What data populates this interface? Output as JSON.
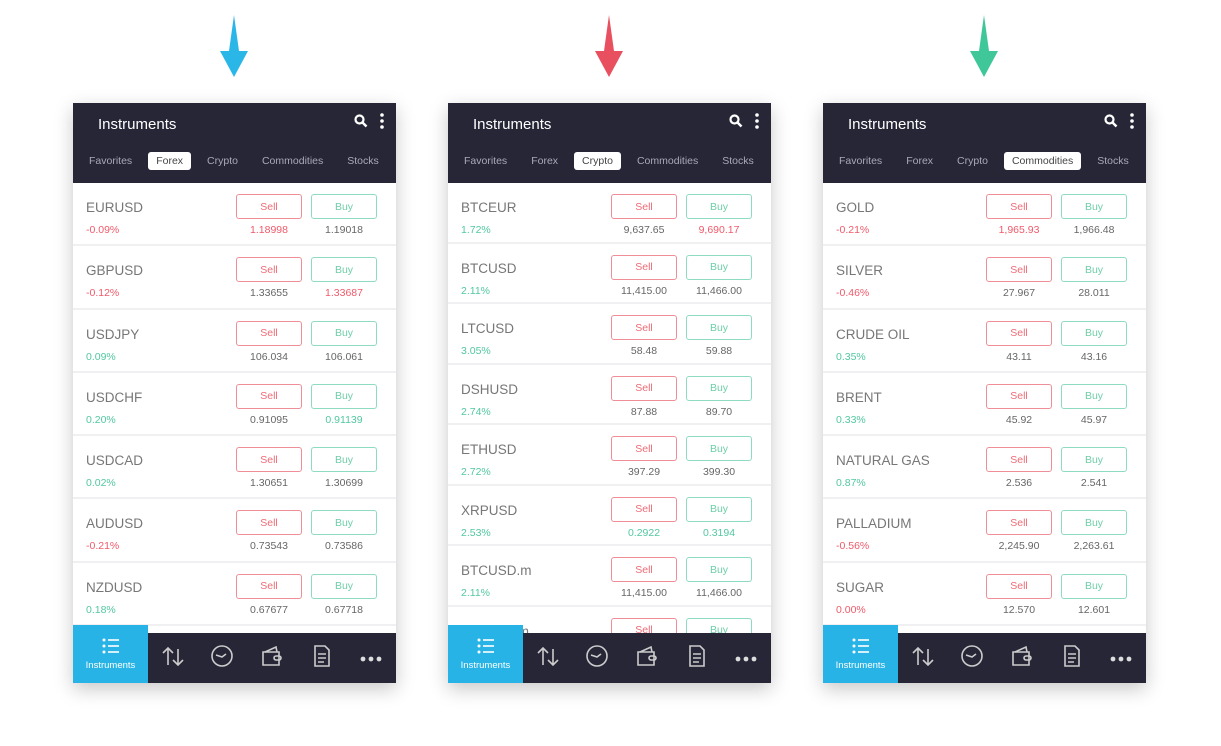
{
  "colors": {
    "arrows": [
      "#2ab7e8",
      "#e8505f",
      "#3fc79a"
    ],
    "accent": "#27b3e6",
    "header_bg": "#262637",
    "up": "#52c8a1",
    "down": "#ef5a6a"
  },
  "panels": [
    {
      "title": "Instruments",
      "tabs": [
        "Favorites",
        "Forex",
        "Crypto",
        "Commodities",
        "Stocks"
      ],
      "active_tab": 1,
      "rows": [
        {
          "name": "EURUSD",
          "change": "-0.09%",
          "change_dir": "down",
          "sell": "1.18998",
          "sell_dir": "down",
          "buy": "1.19018",
          "buy_dir": "neutral"
        },
        {
          "name": "GBPUSD",
          "change": "-0.12%",
          "change_dir": "down",
          "sell": "1.33655",
          "sell_dir": "neutral",
          "buy": "1.33687",
          "buy_dir": "down"
        },
        {
          "name": "USDJPY",
          "change": "0.09%",
          "change_dir": "up",
          "sell": "106.034",
          "sell_dir": "neutral",
          "buy": "106.061",
          "buy_dir": "neutral"
        },
        {
          "name": "USDCHF",
          "change": "0.20%",
          "change_dir": "up",
          "sell": "0.91095",
          "sell_dir": "neutral",
          "buy": "0.91139",
          "buy_dir": "up"
        },
        {
          "name": "USDCAD",
          "change": "0.02%",
          "change_dir": "up",
          "sell": "1.30651",
          "sell_dir": "neutral",
          "buy": "1.30699",
          "buy_dir": "neutral"
        },
        {
          "name": "AUDUSD",
          "change": "-0.21%",
          "change_dir": "down",
          "sell": "0.73543",
          "sell_dir": "neutral",
          "buy": "0.73586",
          "buy_dir": "neutral"
        },
        {
          "name": "NZDUSD",
          "change": "0.18%",
          "change_dir": "up",
          "sell": "0.67677",
          "sell_dir": "neutral",
          "buy": "0.67718",
          "buy_dir": "neutral"
        }
      ]
    },
    {
      "title": "Instruments",
      "tabs": [
        "Favorites",
        "Forex",
        "Crypto",
        "Commodities",
        "Stocks"
      ],
      "active_tab": 2,
      "rows": [
        {
          "name": "BTCEUR",
          "change": "1.72%",
          "change_dir": "up",
          "sell": "9,637.65",
          "sell_dir": "neutral",
          "buy": "9,690.17",
          "buy_dir": "down"
        },
        {
          "name": "BTCUSD",
          "change": "2.11%",
          "change_dir": "up",
          "sell": "11,415.00",
          "sell_dir": "neutral",
          "buy": "11,466.00",
          "buy_dir": "neutral"
        },
        {
          "name": "LTCUSD",
          "change": "3.05%",
          "change_dir": "up",
          "sell": "58.48",
          "sell_dir": "neutral",
          "buy": "59.88",
          "buy_dir": "neutral"
        },
        {
          "name": "DSHUSD",
          "change": "2.74%",
          "change_dir": "up",
          "sell": "87.88",
          "sell_dir": "neutral",
          "buy": "89.70",
          "buy_dir": "neutral"
        },
        {
          "name": "ETHUSD",
          "change": "2.72%",
          "change_dir": "up",
          "sell": "397.29",
          "sell_dir": "neutral",
          "buy": "399.30",
          "buy_dir": "neutral"
        },
        {
          "name": "XRPUSD",
          "change": "2.53%",
          "change_dir": "up",
          "sell": "0.2922",
          "sell_dir": "up",
          "buy": "0.3194",
          "buy_dir": "up"
        },
        {
          "name": "BTCUSD.m",
          "change": "2.11%",
          "change_dir": "up",
          "sell": "11,415.00",
          "sell_dir": "neutral",
          "buy": "11,466.00",
          "buy_dir": "neutral"
        },
        {
          "name": "LTCUSD.m",
          "change": "",
          "change_dir": "up",
          "sell": "",
          "sell_dir": "neutral",
          "buy": "",
          "buy_dir": "neutral"
        }
      ]
    },
    {
      "title": "Instruments",
      "tabs": [
        "Favorites",
        "Forex",
        "Crypto",
        "Commodities",
        "Stocks"
      ],
      "active_tab": 3,
      "rows": [
        {
          "name": "GOLD",
          "change": "-0.21%",
          "change_dir": "down",
          "sell": "1,965.93",
          "sell_dir": "down",
          "buy": "1,966.48",
          "buy_dir": "neutral"
        },
        {
          "name": "SILVER",
          "change": "-0.46%",
          "change_dir": "down",
          "sell": "27.967",
          "sell_dir": "neutral",
          "buy": "28.011",
          "buy_dir": "neutral"
        },
        {
          "name": "CRUDE OIL",
          "change": "0.35%",
          "change_dir": "up",
          "sell": "43.11",
          "sell_dir": "neutral",
          "buy": "43.16",
          "buy_dir": "neutral"
        },
        {
          "name": "BRENT",
          "change": "0.33%",
          "change_dir": "up",
          "sell": "45.92",
          "sell_dir": "neutral",
          "buy": "45.97",
          "buy_dir": "neutral"
        },
        {
          "name": "NATURAL GAS",
          "change": "0.87%",
          "change_dir": "up",
          "sell": "2.536",
          "sell_dir": "neutral",
          "buy": "2.541",
          "buy_dir": "neutral"
        },
        {
          "name": "PALLADIUM",
          "change": "-0.56%",
          "change_dir": "down",
          "sell": "2,245.90",
          "sell_dir": "neutral",
          "buy": "2,263.61",
          "buy_dir": "neutral"
        },
        {
          "name": "SUGAR",
          "change": "0.00%",
          "change_dir": "down",
          "sell": "12.570",
          "sell_dir": "neutral",
          "buy": "12.601",
          "buy_dir": "neutral"
        }
      ]
    }
  ],
  "buttons": {
    "sell": "Sell",
    "buy": "Buy"
  },
  "nav": {
    "active_label": "Instruments",
    "icons": [
      "list-icon",
      "trade-arrows-icon",
      "clock-icon",
      "wallet-icon",
      "document-icon",
      "more-icon"
    ]
  }
}
